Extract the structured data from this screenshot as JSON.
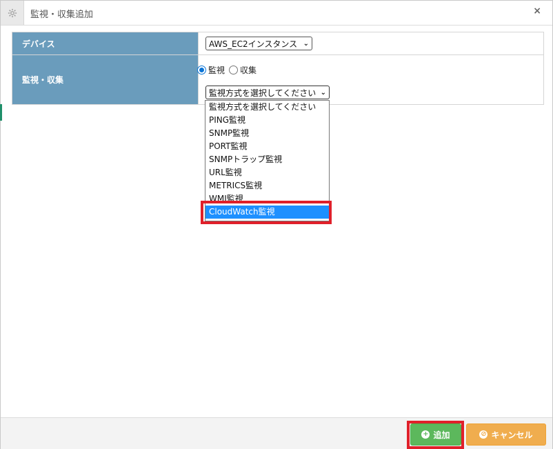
{
  "dialog": {
    "title": "監視・収集追加",
    "close_label": "×"
  },
  "form": {
    "device_label": "デバイス",
    "device_value": "AWS_EC2インスタンス",
    "monitor_label": "監視・収集",
    "radio_monitor": "監視",
    "radio_collect": "収集",
    "method_select_value": "監視方式を選択してください"
  },
  "dropdown": {
    "options": [
      "監視方式を選択してください",
      "PING監視",
      "SNMP監視",
      "PORT監視",
      "SNMPトラップ監視",
      "URL監視",
      "METRICS監視",
      "WMI監視",
      "CloudWatch監視"
    ],
    "highlighted": "CloudWatch監視"
  },
  "footer": {
    "add_label": "追加",
    "cancel_label": "キャンセル"
  },
  "colors": {
    "label_bg": "#6a9cbc",
    "highlight": "#1e90ff",
    "add_button": "#5cb85c",
    "cancel_button": "#f0ad4e",
    "annotation_red": "#e0202a"
  }
}
